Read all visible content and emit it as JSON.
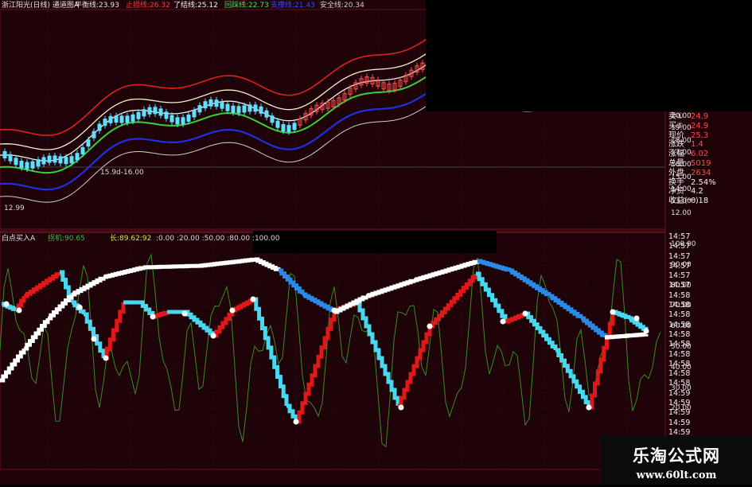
{
  "header": {
    "title": "浙江阳光(日线) 通道图A",
    "items": [
      {
        "label": "平衡线:23.93",
        "color": "#e8e8e8"
      },
      {
        "label": "止损线:26.32",
        "color": "#ff3b3b"
      },
      {
        "label": "了结线:25.12",
        "color": "#f2f2f2"
      },
      {
        "label": "回踩线:22.73",
        "color": "#46e046"
      },
      {
        "label": "支撑线:21.43",
        "color": "#3a4cff"
      },
      {
        "label": "安全线:20.34",
        "color": "#cfcfcf"
      }
    ]
  },
  "upper_axis": [
    "20.00",
    "19.00",
    "18.00",
    "17.00",
    "16.00",
    "15.00",
    "14.00",
    "13.00",
    "12.00"
  ],
  "annotations": {
    "low_price": "12.99",
    "mid_price": "15.9d-16.00"
  },
  "quote_panel": [
    {
      "label": "卖①",
      "value": "24.9"
    },
    {
      "label": "买⑤",
      "value": "24.9"
    },
    {
      "label": "现价",
      "value": "25.3"
    },
    {
      "label": "涨跌",
      "value": "1.4"
    },
    {
      "label": "涨幅",
      "value": "6.02"
    },
    {
      "label": "总量",
      "value": "5019"
    },
    {
      "label": "外盘",
      "value": "2634"
    },
    {
      "label": "换手",
      "value": "2.54%"
    },
    {
      "label": "净资",
      "value": "4.2"
    },
    {
      "label": "收益(一)",
      "value": "0.18"
    }
  ],
  "indicator": {
    "title": "白点买入A",
    "items": [
      {
        "label": "拐机:90.65",
        "color": "#3fbf3f"
      },
      {
        "label": "长:89.62:92",
        "color": "#e0e060"
      }
    ],
    "levels": ":0.00 :20.00 :50.00 :80.00 :100.00"
  },
  "lower_axis": [
    "100.00",
    "90.00",
    "80.00",
    "70.00",
    "60.00",
    "50.00",
    "40.00",
    "30.00",
    "20.00"
  ],
  "time_list": [
    "14:57",
    "14:57",
    "14:57",
    "14:57",
    "14:57",
    "14:57",
    "14:58",
    "14:58",
    "14:58",
    "14:58",
    "14:58",
    "14:58",
    "14:58",
    "14:58",
    "14:58",
    "14:58",
    "14:59",
    "14:59",
    "14:59",
    "14:59",
    "14:59",
    "14:59",
    "14:59",
    "14:59",
    "14:59",
    "14:59"
  ],
  "watermark": {
    "title": "乐淘公式网",
    "url": "www.60lt.com"
  },
  "colors": {
    "bg": "#1e0308",
    "grid": "#6a1020"
  }
}
